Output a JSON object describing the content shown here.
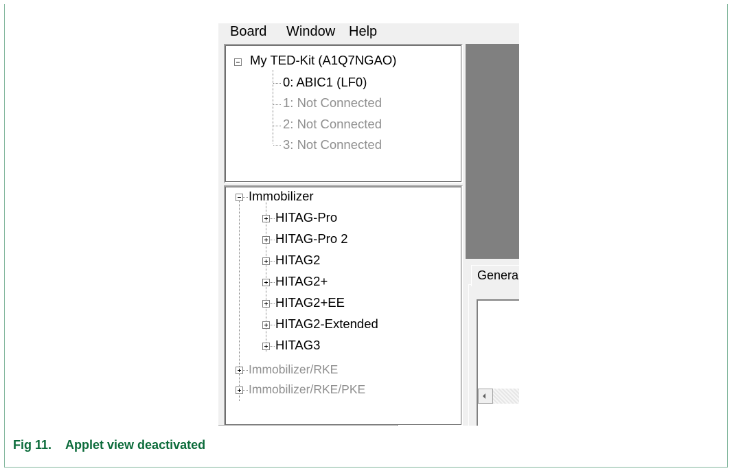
{
  "menu": {
    "board": "Board",
    "window": "Window",
    "help": "Help"
  },
  "device_tree": {
    "root": "My TED-Kit (A1Q7NGAO)",
    "slots": [
      {
        "label": "0: ABIC1 (LF0)",
        "state": "connected"
      },
      {
        "label": "1: Not Connected",
        "state": "disconnected"
      },
      {
        "label": "2: Not Connected",
        "state": "disconnected"
      },
      {
        "label": "3: Not Connected",
        "state": "disconnected"
      }
    ]
  },
  "applet_tree": {
    "root": "Immobilizer",
    "children": [
      "HITAG-Pro",
      "HITAG-Pro 2",
      "HITAG2",
      "HITAG2+",
      "HITAG2+EE",
      "HITAG2-Extended",
      "HITAG3"
    ],
    "other": [
      {
        "label": "Immobilizer/RKE",
        "state": "disabled"
      },
      {
        "label": "Immobilizer/RKE/PKE",
        "state": "disabled"
      }
    ]
  },
  "tab": {
    "label": "Genera"
  },
  "caption": {
    "number": "Fig 11.",
    "text": "Applet view deactivated"
  },
  "colors": {
    "caption": "#0b6b3a",
    "frame": "#7fb59b",
    "disabled_text": "#8f8f8f",
    "gray_area": "#808080"
  }
}
